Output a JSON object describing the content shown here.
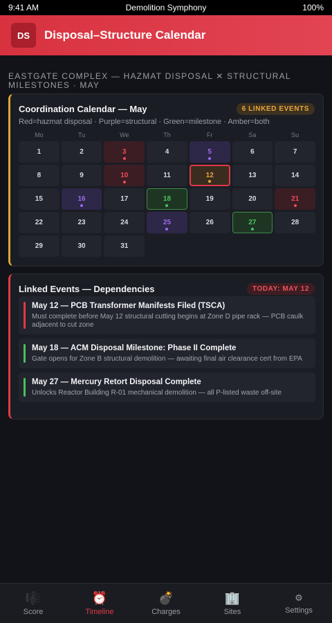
{
  "status": {
    "time": "9:41 AM",
    "carrier": "Demolition Symphony",
    "battery": "100%"
  },
  "header": {
    "avatar_initials": "DS",
    "title": "Disposal–Structure Calendar"
  },
  "section_caption": "EASTGATE COMPLEX — HAZMAT DISPOSAL ✕ STRUCTURAL MILESTONES · MAY",
  "calendar": {
    "title": "Coordination Calendar — May",
    "badge": "6 LINKED EVENTS",
    "legend": "Red=hazmat disposal · Purple=structural · Green=milestone · Amber=both",
    "weekdays": [
      "Mo",
      "Tu",
      "We",
      "Th",
      "Fr",
      "Sa",
      "Su"
    ],
    "days": [
      {
        "n": "1",
        "t": ""
      },
      {
        "n": "2",
        "t": ""
      },
      {
        "n": "3",
        "t": "hazmat"
      },
      {
        "n": "4",
        "t": ""
      },
      {
        "n": "5",
        "t": "structural"
      },
      {
        "n": "6",
        "t": ""
      },
      {
        "n": "7",
        "t": ""
      },
      {
        "n": "8",
        "t": ""
      },
      {
        "n": "9",
        "t": ""
      },
      {
        "n": "10",
        "t": "hazmat"
      },
      {
        "n": "11",
        "t": ""
      },
      {
        "n": "12",
        "t": "both"
      },
      {
        "n": "13",
        "t": ""
      },
      {
        "n": "14",
        "t": ""
      },
      {
        "n": "15",
        "t": ""
      },
      {
        "n": "16",
        "t": "structural"
      },
      {
        "n": "17",
        "t": ""
      },
      {
        "n": "18",
        "t": "milestone"
      },
      {
        "n": "19",
        "t": ""
      },
      {
        "n": "20",
        "t": ""
      },
      {
        "n": "21",
        "t": "hazmat"
      },
      {
        "n": "22",
        "t": ""
      },
      {
        "n": "23",
        "t": ""
      },
      {
        "n": "24",
        "t": ""
      },
      {
        "n": "25",
        "t": "structural"
      },
      {
        "n": "26",
        "t": ""
      },
      {
        "n": "27",
        "t": "milestone"
      },
      {
        "n": "28",
        "t": ""
      },
      {
        "n": "29",
        "t": ""
      },
      {
        "n": "30",
        "t": ""
      },
      {
        "n": "31",
        "t": ""
      }
    ]
  },
  "events": {
    "title": "Linked Events — Dependencies",
    "badge": "TODAY: MAY 12",
    "items": [
      {
        "title": "May 12 — PCB Transformer Manifests Filed (TSCA)",
        "desc": "Must complete before May 12 structural cutting begins at Zone D pipe rack — PCB caulk adjacent to cut zone",
        "color": "red"
      },
      {
        "title": "May 18 — ACM Disposal Milestone: Phase II Complete",
        "desc": "Gate opens for Zone B structural demolition — awaiting final air clearance cert from EPA",
        "color": "green"
      },
      {
        "title": "May 27 — Mercury Retort Disposal Complete",
        "desc": "Unlocks Reactor Building R-01 mechanical demolition — all P-listed waste off-site",
        "color": "green"
      }
    ]
  },
  "tabs": [
    {
      "label": "Score",
      "icon": "🎼",
      "icon_name": "score-icon",
      "active": false
    },
    {
      "label": "Timeline",
      "icon": "⏰",
      "icon_name": "alarm-clock-icon",
      "active": true
    },
    {
      "label": "Charges",
      "icon": "💣",
      "icon_name": "bomb-icon",
      "active": false
    },
    {
      "label": "Sites",
      "icon": "🏢",
      "icon_name": "building-icon",
      "active": false
    },
    {
      "label": "Settings",
      "icon": "⚙",
      "icon_name": "gear-icon",
      "active": false
    }
  ]
}
